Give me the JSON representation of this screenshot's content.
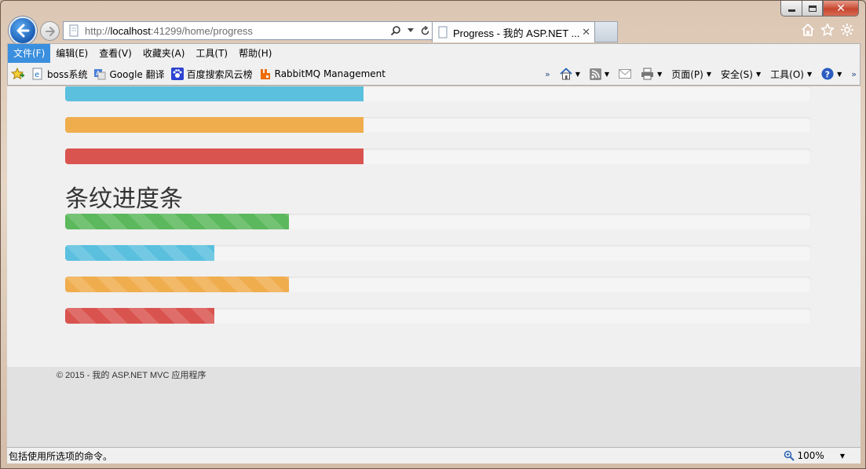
{
  "window": {
    "close_glyph": "✕"
  },
  "address": {
    "url_prefix": "http://",
    "url_host": "localhost",
    "url_rest": ":41299/home/progress"
  },
  "tab": {
    "title": "Progress - 我的 ASP.NET ...",
    "close": "✕"
  },
  "menu": [
    "文件(F)",
    "编辑(E)",
    "查看(V)",
    "收藏夹(A)",
    "工具(T)",
    "帮助(H)"
  ],
  "favorites": [
    {
      "label": "boss系统",
      "icon": "ie-page-icon"
    },
    {
      "label": "Google 翻译",
      "icon": "translate-icon"
    },
    {
      "label": "百度搜索风云榜",
      "icon": "baidu-paw-icon"
    },
    {
      "label": "RabbitMQ Management",
      "icon": "rabbitmq-icon"
    }
  ],
  "commands": {
    "page": "页面(P)",
    "safety": "安全(S)",
    "tools": "工具(O)"
  },
  "progress": {
    "basic": [
      {
        "type": "info",
        "percent": 40
      },
      {
        "type": "warning",
        "percent": 40
      },
      {
        "type": "danger",
        "percent": 40
      }
    ],
    "striped_heading": "条纹进度条",
    "striped": [
      {
        "type": "success",
        "percent": 30
      },
      {
        "type": "info",
        "percent": 20
      },
      {
        "type": "warning",
        "percent": 30
      },
      {
        "type": "danger",
        "percent": 20
      }
    ]
  },
  "footer": {
    "text": "© 2015 - 我的 ASP.NET MVC 应用程序"
  },
  "status": {
    "message": "包括使用所选项的命令。",
    "zoom": "100%"
  },
  "colors": {
    "success": "#5cb85c",
    "info": "#5bc0de",
    "warning": "#f0ad4e",
    "danger": "#d9534f"
  }
}
